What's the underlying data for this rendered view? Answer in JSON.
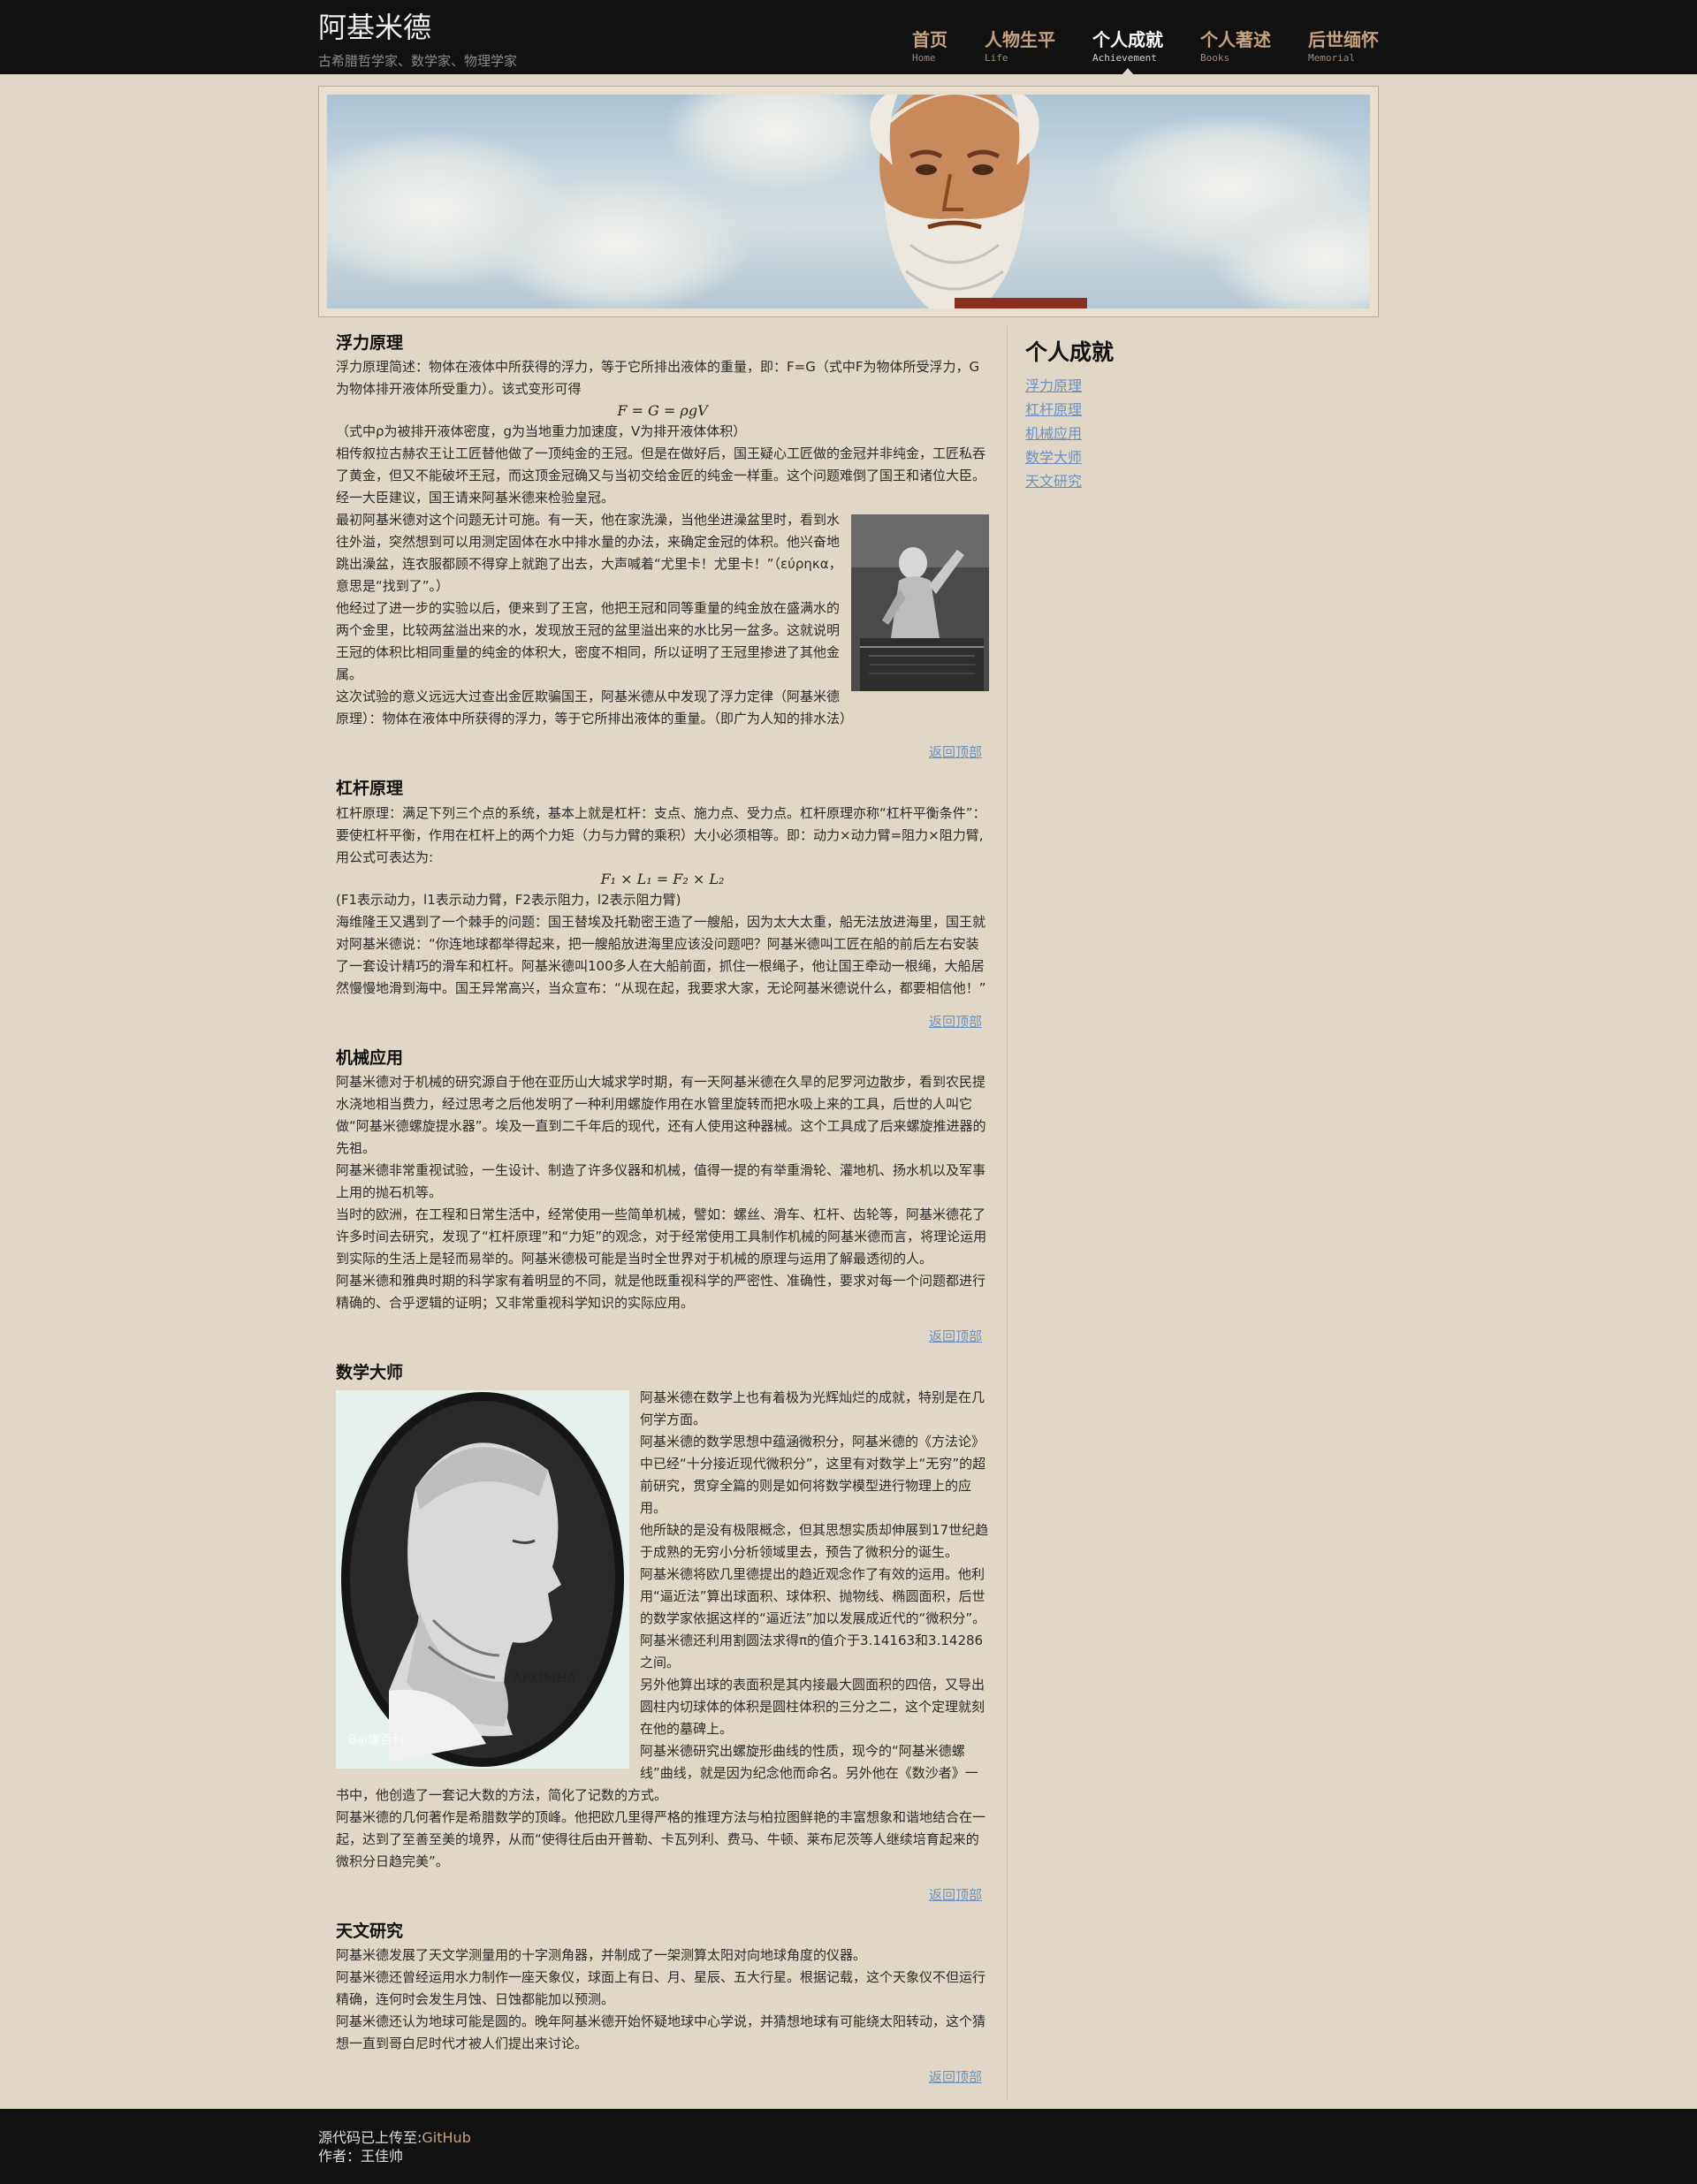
{
  "header": {
    "title": "阿基米德",
    "subtitle": "古希腊哲学家、数学家、物理学家",
    "nav": [
      {
        "label": "首页",
        "sub": "Home"
      },
      {
        "label": "人物生平",
        "sub": "Life"
      },
      {
        "label": "个人成就",
        "sub": "Achievement"
      },
      {
        "label": "个人著述",
        "sub": "Books"
      },
      {
        "label": "后世缅怀",
        "sub": "Memorial"
      }
    ],
    "active_nav": "个人成就"
  },
  "sections": {
    "buoyancy": {
      "title": "浮力原理",
      "p1": "浮力原理简述：物体在液体中所获得的浮力，等于它所排出液体的重量，即：F=G（式中F为物体所受浮力，G为物体排开液体所受重力）。该式变形可得",
      "formula": "F = G = ρgV",
      "p2": "（式中ρ为被排开液体密度，g为当地重力加速度，V为排开液体体积）",
      "p3": "相传叙拉古赫农王让工匠替他做了一顶纯金的王冠。但是在做好后，国王疑心工匠做的金冠并非纯金，工匠私吞了黄金，但又不能破坏王冠，而这顶金冠确又与当初交给金匠的纯金一样重。这个问题难倒了国王和诸位大臣。经一大臣建议，国王请来阿基米德来检验皇冠。",
      "p4": "最初阿基米德对这个问题无计可施。有一天，他在家洗澡，当他坐进澡盆里时，看到水往外溢，突然想到可以用测定固体在水中排水量的办法，来确定金冠的体积。他兴奋地跳出澡盆，连衣服都顾不得穿上就跑了出去，大声喊着“尤里卡！尤里卡！”（εύρηκα，意思是“找到了”。）",
      "p5": "他经过了进一步的实验以后，便来到了王宫，他把王冠和同等重量的纯金放在盛满水的两个金里，比较两盆溢出来的水，发现放王冠的盆里溢出来的水比另一盆多。这就说明王冠的体积比相同重量的纯金的体积大，密度不相同，所以证明了王冠里掺进了其他金属。",
      "p6": "这次试验的意义远远大过查出金匠欺骗国王，阿基米德从中发现了浮力定律（阿基米德原理）：物体在液体中所获得的浮力，等于它所排出液体的重量。（即广为人知的排水法）",
      "figure": "bathing-statue-image"
    },
    "lever": {
      "title": "杠杆原理",
      "p1": "杠杆原理：满足下列三个点的系统，基本上就是杠杆：支点、施力点、受力点。杠杆原理亦称“杠杆平衡条件”：要使杠杆平衡，作用在杠杆上的两个力矩（力与力臂的乘积）大小必须相等。即：动力×动力臂=阻力×阻力臂,用公式可表达为:",
      "formula": "F₁ × L₁ = F₂ × L₂",
      "p2": "(F1表示动力，l1表示动力臂，F2表示阻力，l2表示阻力臂)",
      "p3": "海维隆王又遇到了一个棘手的问题：国王替埃及托勒密王造了一艘船，因为太大太重，船无法放进海里，国王就对阿基米德说：“你连地球都举得起来，把一艘船放进海里应该没问题吧？阿基米德叫工匠在船的前后左右安装了一套设计精巧的滑车和杠杆。阿基米德叫100多人在大船前面，抓住一根绳子，他让国王牵动一根绳，大船居然慢慢地滑到海中。国王异常高兴，当众宣布：“从现在起，我要求大家，无论阿基米德说什么，都要相信他！”"
    },
    "machinery": {
      "title": "机械应用",
      "p1": "阿基米德对于机械的研究源自于他在亚历山大城求学时期，有一天阿基米德在久旱的尼罗河边散步，看到农民提水浇地相当费力，经过思考之后他发明了一种利用螺旋作用在水管里旋转而把水吸上来的工具，后世的人叫它做“阿基米德螺旋提水器”。埃及一直到二千年后的现代，还有人使用这种器械。这个工具成了后来螺旋推进器的先祖。",
      "p2": "阿基米德非常重视试验，一生设计、制造了许多仪器和机械，值得一提的有举重滑轮、灌地机、扬水机以及军事上用的抛石机等。",
      "p3": "当时的欧洲，在工程和日常生活中，经常使用一些简单机械，譬如：螺丝、滑车、杠杆、齿轮等，阿基米德花了许多时间去研究，发现了“杠杆原理”和“力矩”的观念，对于经常使用工具制作机械的阿基米德而言，将理论运用到实际的生活上是轻而易举的。阿基米德极可能是当时全世界对于机械的原理与运用了解最透彻的人。",
      "p4": "阿基米德和雅典时期的科学家有着明显的不同，就是他既重视科学的严密性、准确性，要求对每一个问题都进行精确的、合乎逻辑的证明；又非常重视科学知识的实际应用。"
    },
    "math": {
      "title": "数学大师",
      "p1": "阿基米德在数学上也有着极为光辉灿烂的成就，特别是在几何学方面。",
      "p2": "阿基米德的数学思想中蕴涵微积分，阿基米德的《方法论》中已经“十分接近现代微积分”，这里有对数学上“无穷”的超前研究，贯穿全篇的则是如何将数学模型进行物理上的应用。",
      "p3": "他所缺的是没有极限概念，但其思想实质却伸展到17世纪趋于成熟的无穷小分析领域里去，预告了微积分的诞生。",
      "p4": "阿基米德将欧几里德提出的趋近观念作了有效的运用。他利用“逼近法”算出球面积、球体积、抛物线、椭圆面积，后世的数学家依据这样的“逼近法”加以发展成近代的“微积分”。阿基米德还利用割圆法求得π的值介于3.14163和3.14286之间。",
      "p5": "另外他算出球的表面积是其内接最大圆面积的四倍，又导出圆柱内切球体的体积是圆柱体积的三分之二，这个定理就刻在他的墓碑上。",
      "p6": "阿基米德研究出螺旋形曲线的性质，现今的“阿基米德螺线”曲线，就是因为纪念他而命名。另外他在《数沙者》一书中，他创造了一套记大数的方法，简化了记数的方式。",
      "p7": "阿基米德的几何著作是希腊数学的顶峰。他把欧几里得严格的推理方法与柏拉图鲜艳的丰富想象和谐地结合在一起，达到了至善至美的境界，从而“使得往后由开普勒、卡瓦列利、费马、牛顿、莱布尼茨等人继续培育起来的微积分日趋完美”。",
      "figure": "archimedes-portrait-image",
      "portrait_inscription": "ΑΡΧΙΜΗΔ",
      "watermark": "Bai度百科"
    },
    "astronomy": {
      "title": "天文研究",
      "p1": "阿基米德发展了天文学测量用的十字测角器，并制成了一架测算太阳对向地球角度的仪器。",
      "p2": "阿基米德还曾经运用水力制作一座天象仪，球面上有日、月、星辰、五大行星。根据记载，这个天象仪不但运行精确，连何时会发生月蚀、日蚀都能加以预测。",
      "p3": "阿基米德还认为地球可能是圆的。晚年阿基米德开始怀疑地球中心学说，并猜想地球有可能绕太阳转动，这个猜想一直到哥白尼时代才被人们提出来讨论。"
    }
  },
  "back_to_top_label": "返回顶部",
  "sidebar": {
    "title": "个人成就",
    "links": [
      "浮力原理",
      "杠杆原理",
      "机械应用",
      "数学大师",
      "天文研究"
    ]
  },
  "footer": {
    "source_prefix": "源代码已上传至:",
    "source_link": "GitHub",
    "author": "作者：王佳帅"
  },
  "colors": {
    "page_bg": "#e0d7c6",
    "header_bg": "#111111",
    "nav_text": "#c6a27f",
    "link": "#6e90c0"
  },
  "icons": {
    "active_nav_indicator": "triangle-up-icon"
  }
}
